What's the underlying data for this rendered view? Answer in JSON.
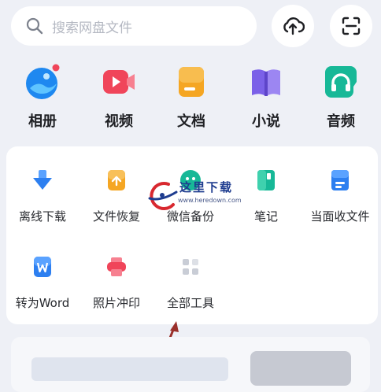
{
  "search": {
    "placeholder": "搜索网盘文件"
  },
  "header_buttons": [
    {
      "icon": "cloud-upload-icon"
    },
    {
      "icon": "scan-icon"
    }
  ],
  "categories": [
    {
      "label": "相册",
      "icon": "photo-album-icon",
      "color": "#1e88f0",
      "badge": true
    },
    {
      "label": "视频",
      "icon": "video-icon",
      "color": "#f0455a"
    },
    {
      "label": "文档",
      "icon": "document-icon",
      "color": "#f5a623"
    },
    {
      "label": "小说",
      "icon": "novel-book-icon",
      "color": "#7b61e8"
    },
    {
      "label": "音频",
      "icon": "audio-headphone-icon",
      "color": "#17b897"
    }
  ],
  "tools": [
    {
      "label": "离线下载",
      "icon": "offline-download-icon",
      "color": "#2d7ff0"
    },
    {
      "label": "文件恢复",
      "icon": "file-restore-icon",
      "color": "#f5a623"
    },
    {
      "label": "微信备份",
      "icon": "wechat-backup-icon",
      "color": "#17b897"
    },
    {
      "label": "笔记",
      "icon": "notes-icon",
      "color": "#17b897"
    },
    {
      "label": "当面收文件",
      "icon": "receive-file-icon",
      "color": "#2d7ff0"
    },
    {
      "label": "转为Word",
      "icon": "convert-word-icon",
      "color": "#2d7ff0"
    },
    {
      "label": "照片冲印",
      "icon": "photo-print-icon",
      "color": "#f0455a"
    },
    {
      "label": "全部工具",
      "icon": "all-tools-icon",
      "color": "#c9cdd6"
    }
  ],
  "watermark": {
    "text": "这里下载",
    "url": "www.heredown.com"
  }
}
